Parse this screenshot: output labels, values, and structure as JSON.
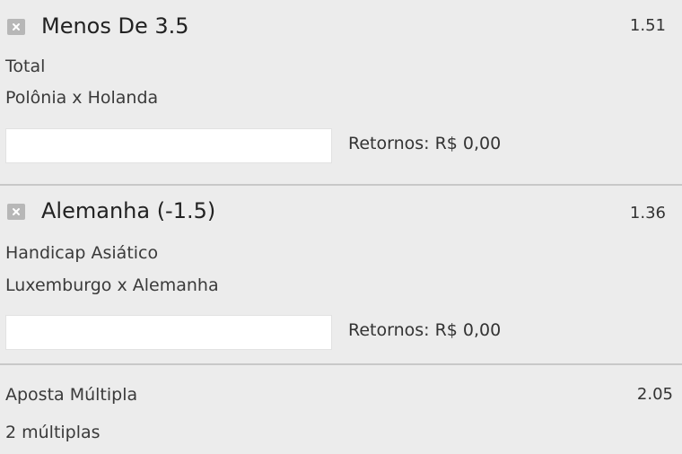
{
  "bets": [
    {
      "selection": "Menos De 3.5",
      "odds": "1.51",
      "market": "Total",
      "fixture": "Polônia x Holanda",
      "stake_value": "",
      "returns": "Retornos: R$ 0,00"
    },
    {
      "selection": "Alemanha (-1.5)",
      "odds": "1.36",
      "market": "Handicap Asiático",
      "fixture": "Luxemburgo x Alemanha",
      "stake_value": "",
      "returns": "Retornos: R$ 0,00"
    }
  ],
  "multiple": {
    "title": "Aposta Múltipla",
    "odds": "2.05",
    "count": "2 múltiplas"
  },
  "colors": {
    "background": "#ececec",
    "divider": "#c8c8c8",
    "close_icon_bg": "#b7b7b7",
    "input_bg": "#ffffff"
  },
  "icons": {
    "remove": "close-icon"
  }
}
